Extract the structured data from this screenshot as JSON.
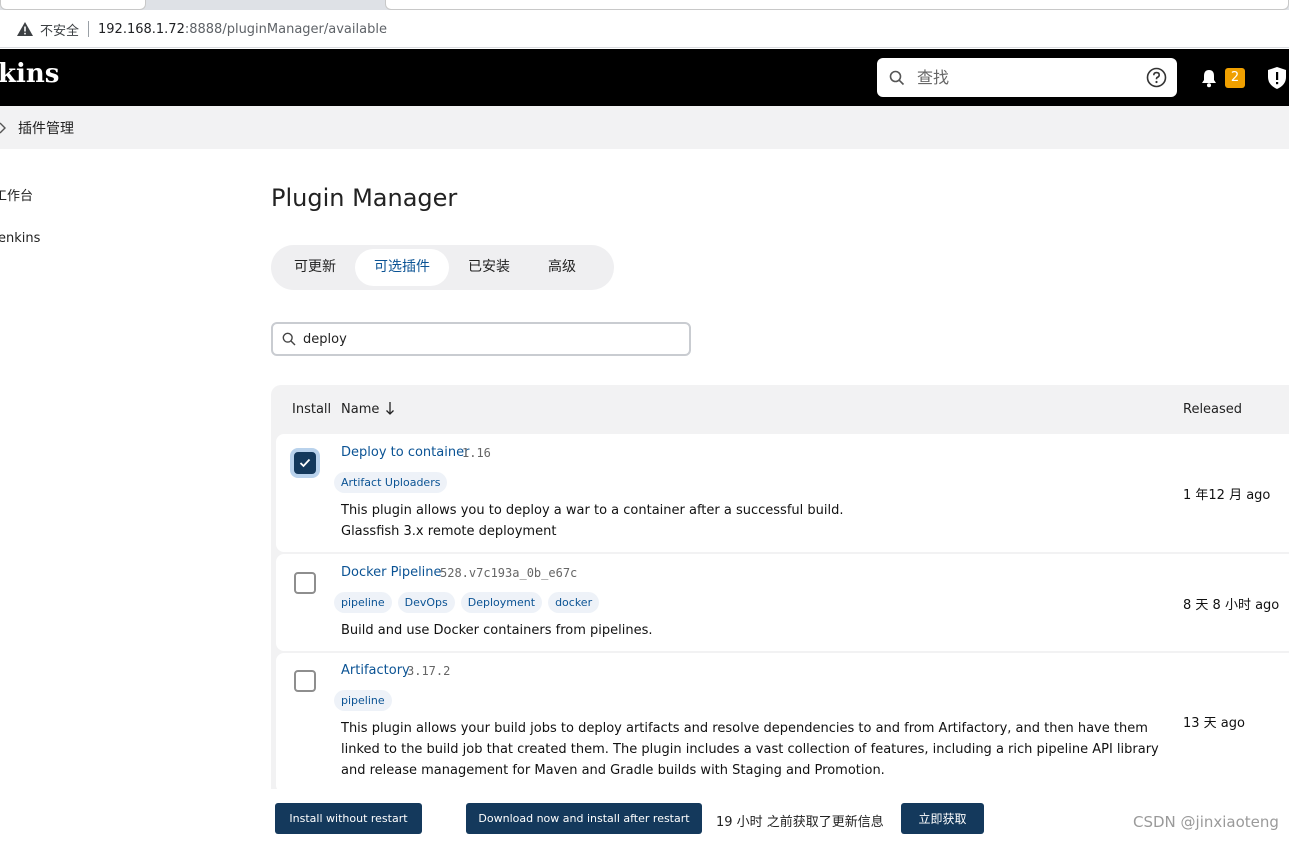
{
  "browser": {
    "insecure_label": "不安全",
    "url_host": "192.168.1.72",
    "url_rest": ":8888/pluginManager/available"
  },
  "header": {
    "logo_text": "kins",
    "search_placeholder": "查找",
    "notification_count": "2"
  },
  "breadcrumb": {
    "current": "插件管理"
  },
  "sidebar": {
    "items": [
      {
        "label": "工作台"
      },
      {
        "label": "enkins"
      }
    ]
  },
  "main": {
    "title": "Plugin Manager",
    "tabs": [
      {
        "label": "可更新",
        "active": false
      },
      {
        "label": "可选插件",
        "active": true
      },
      {
        "label": "已安装",
        "active": false
      },
      {
        "label": "高级",
        "active": false
      }
    ],
    "filter_value": "deploy",
    "table": {
      "headers": {
        "install": "Install",
        "name": "Name",
        "released": "Released"
      },
      "rows": [
        {
          "checked": true,
          "name": "Deploy to container",
          "version": "1.16",
          "tags": [
            "Artifact Uploaders"
          ],
          "description": [
            "This plugin allows you to deploy a war to a container after a successful build.",
            "Glassfish 3.x remote deployment"
          ],
          "released": "1 年12 月 ago"
        },
        {
          "checked": false,
          "name": "Docker Pipeline",
          "version": "528.v7c193a_0b_e67c",
          "tags": [
            "pipeline",
            "DevOps",
            "Deployment",
            "docker"
          ],
          "description": [
            "Build and use Docker containers from pipelines."
          ],
          "released": "8 天 8 小时 ago"
        },
        {
          "checked": false,
          "name": "Artifactory",
          "version": "3.17.2",
          "tags": [
            "pipeline"
          ],
          "description": [
            "This plugin allows your build jobs to deploy artifacts and resolve dependencies to and from Artifactory, and then have them linked to the build job that created them. The plugin includes a vast collection of features, including a rich pipeline API library and release management for Maven and Gradle builds with Staging and Promotion."
          ],
          "released": "13 天 ago"
        }
      ]
    }
  },
  "bottom": {
    "install_without_restart": "Install without restart",
    "download_install_after_restart": "Download now and install after restart",
    "update_info": "19 小时 之前获取了更新信息",
    "fetch_now": "立即获取"
  },
  "watermark": "CSDN @jinxiaoteng",
  "colors": {
    "primary": "#14395c",
    "link": "#0b5394",
    "header_bg": "#000000",
    "badge": "#f0a000"
  }
}
